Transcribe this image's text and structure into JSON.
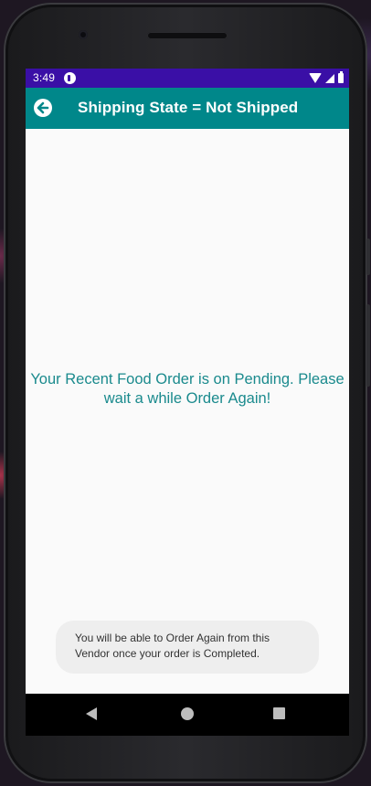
{
  "status_bar": {
    "time": "3:49",
    "background_color": "#3a0fa6",
    "icons": [
      "app-notification-icon",
      "wifi-icon",
      "signal-icon",
      "battery-icon"
    ]
  },
  "app_bar": {
    "back_icon": "back-arrow-circle-icon",
    "title": "Shipping State = Not Shipped",
    "background_color": "#00878a"
  },
  "main": {
    "message": "Your Recent Food Order is on Pending. Please wait a while Order Again!",
    "message_color": "#1a8a8d"
  },
  "toast": {
    "text": "You will be able to Order Again from this Vendor once your order is Completed."
  },
  "nav_bar": {
    "icons": [
      "nav-back-icon",
      "nav-home-icon",
      "nav-recents-icon"
    ]
  }
}
